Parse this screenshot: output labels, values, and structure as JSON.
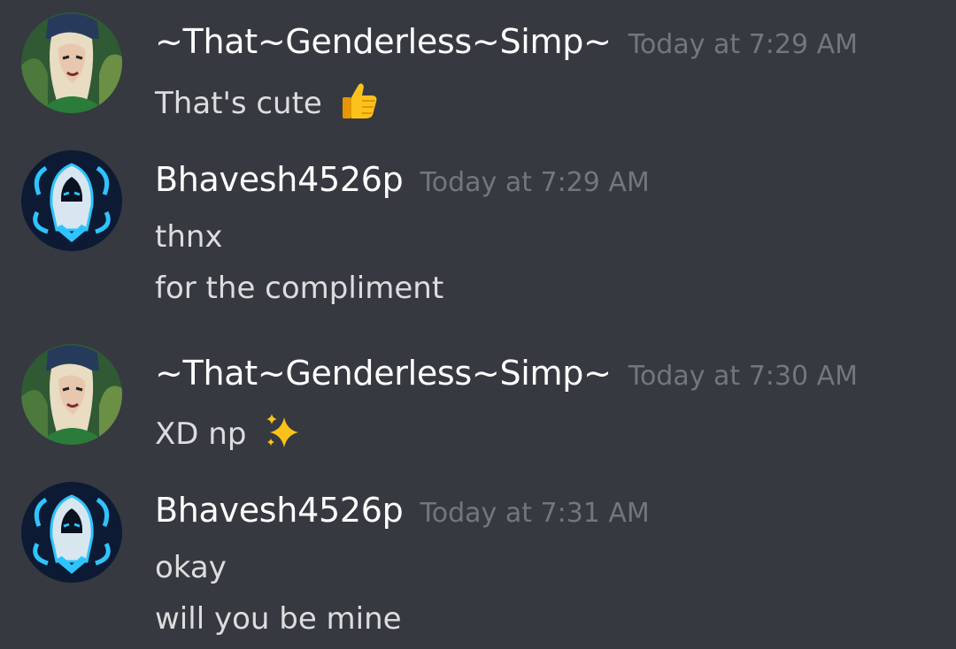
{
  "messages": [
    {
      "author": "~That~Genderless~Simp~",
      "timestamp": "Today at 7:29 AM",
      "avatar": "girl-portrait-avatar",
      "lines": [
        {
          "text": "That's cute",
          "emoji": "thumbs-up-icon"
        }
      ]
    },
    {
      "author": "Bhavesh4526p",
      "timestamp": "Today at 7:29 AM",
      "avatar": "hooded-assassin-avatar",
      "lines": [
        {
          "text": "thnx"
        },
        {
          "text": "for the compliment"
        }
      ]
    },
    {
      "author": "~That~Genderless~Simp~",
      "timestamp": "Today at 7:30 AM",
      "avatar": "girl-portrait-avatar",
      "lines": [
        {
          "text": "XD np",
          "emoji": "sparkles-icon"
        }
      ]
    },
    {
      "author": "Bhavesh4526p",
      "timestamp": "Today at 7:31 AM",
      "avatar": "hooded-assassin-avatar",
      "lines": [
        {
          "text": "okay"
        },
        {
          "text": "will you be mine"
        }
      ]
    }
  ],
  "colors": {
    "background": "#36393f",
    "username": "#ffffff",
    "timestamp": "#72767d",
    "message_text": "#dcddde"
  }
}
